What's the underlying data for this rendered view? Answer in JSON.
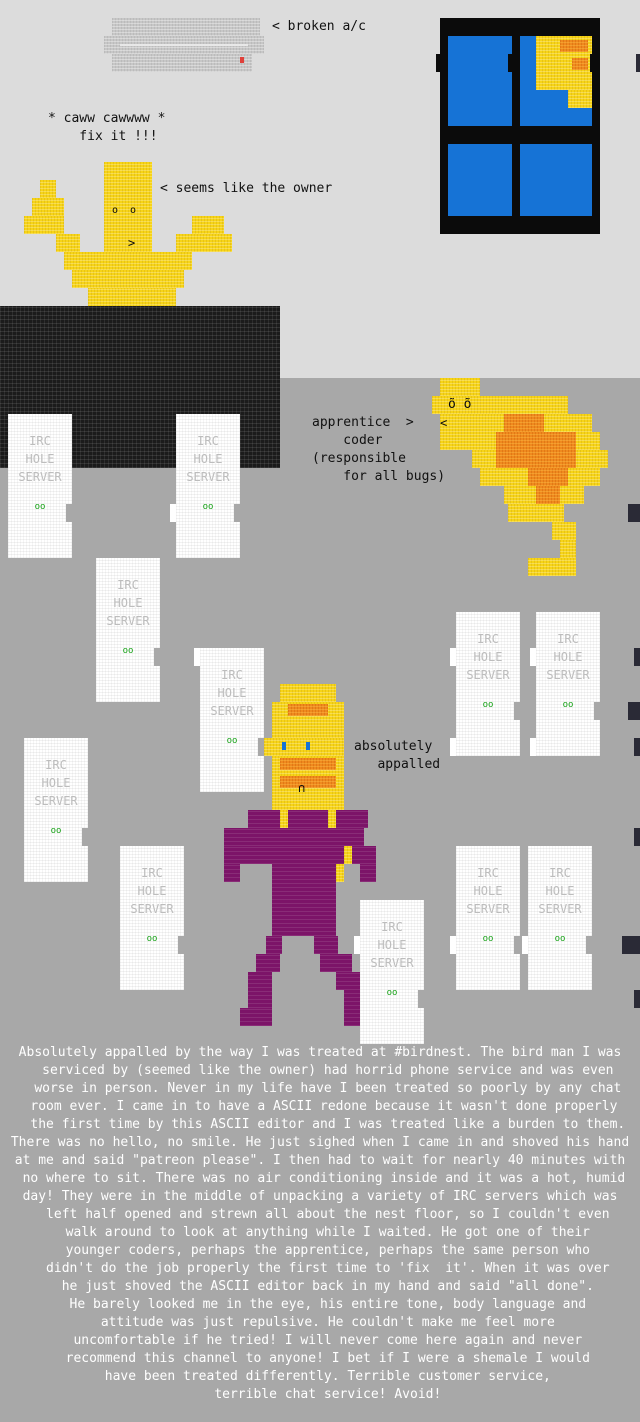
{
  "labels": {
    "broken_ac": "< broken a/c",
    "bird_sound": "* caww cawwww *\n    fix it !!!",
    "owner": "< seems like the owner",
    "apprentice": "apprentice  >\n    coder\n(responsible\n    for all bugs)",
    "appalled": "absolutely\n   appalled"
  },
  "faces": {
    "owner_eyes": "o  o",
    "owner_beak": ">",
    "apprentice_eyes": "õ õ",
    "apprentice_beak": "<",
    "customer_mouth": "∩"
  },
  "server": {
    "text": "IRC\nHOLE\nSERVER",
    "led": "oo"
  },
  "review": "Absolutely appalled by the way I was treated at #birdnest. The bird man I was\n  serviced by (seemed like the owner) had horrid phone service and was even\n  worse in person. Never in my life have I been treated so poorly by any chat\n room ever. I came in to have a ASCII redone because it wasn't done properly\n  the first time by this ASCII editor and I was treated like a burden to them.\nThere was no hello, no smile. He just sighed when I came in and shoved his hand\nat me and said \"patreon please\". I then had to wait for nearly 40 minutes with\n no where to sit. There was no air conditioning inside and it was a hot, humid\nday! They were in the middle of unpacking a variety of IRC servers which was\n  left half opened and strewn all about the nest floor, so I couldn't even\n  walk around to look at anything while I waited. He got one of their\n  younger coders, perhaps the apprentice, perhaps the same person who\n  didn't do the job properly the first time to 'fix  it'. When it was over\n  he just shoved the ASCII editor back in my hand and said \"all done\".\n  He barely looked me in the eye, his entire tone, body language and\n  attitude was just repulsive. He couldn't make me feel more\n  uncomfortable if he tried! I will never come here again and never\n  recommend this channel to anyone! I bet if I were a shemale I would\n  have been treated differently. Terrible customer service,\n  terrible chat service! Avoid!",
  "colors": {
    "floor": "#a8a8a8",
    "wall": "#dcdcdc",
    "bird_yellow": "#f7d418",
    "bird_orange": "#f08a1e",
    "sky_blue": "#1673d6",
    "customer_purple": "#7c1468",
    "counter_dark": "#1b1b1b"
  }
}
